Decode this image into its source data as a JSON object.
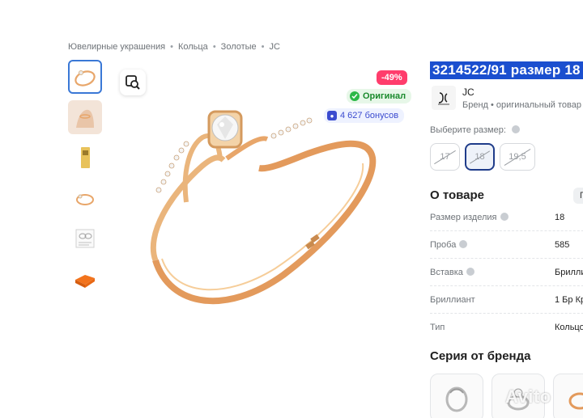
{
  "breadcrumb": [
    "Ювелирные украшения",
    "Кольца",
    "Золотые",
    "JC"
  ],
  "breadcrumb_sep": "•",
  "badges": {
    "discount": "-49%",
    "original": "Оригинал",
    "bonus": "4 627 бонусов"
  },
  "product": {
    "title": "3214522/91 размер 18",
    "brand": "JC",
    "brand_sub": "Бренд • оригинальный товар"
  },
  "sizes": {
    "label": "Выберите размер:",
    "options": [
      "17",
      "18",
      "19,5"
    ],
    "selected": "18"
  },
  "about": {
    "heading": "О товаре",
    "chip": "П",
    "specs": [
      {
        "label": "Размер изделия",
        "value": "18"
      },
      {
        "label": "Проба",
        "value": "585"
      },
      {
        "label": "Вставка",
        "value": "Брилли"
      },
      {
        "label": "Бриллиант",
        "value": "1 Бр Кр"
      },
      {
        "label": "Тип",
        "value": "Кольцо"
      }
    ]
  },
  "series_heading": "Серия от бренда",
  "watermark": "Avito",
  "colors": {
    "accent": "#1b4fcf",
    "discount": "#ff3d6c",
    "original": "#1a8a2c",
    "gold": "#e8a66a"
  }
}
